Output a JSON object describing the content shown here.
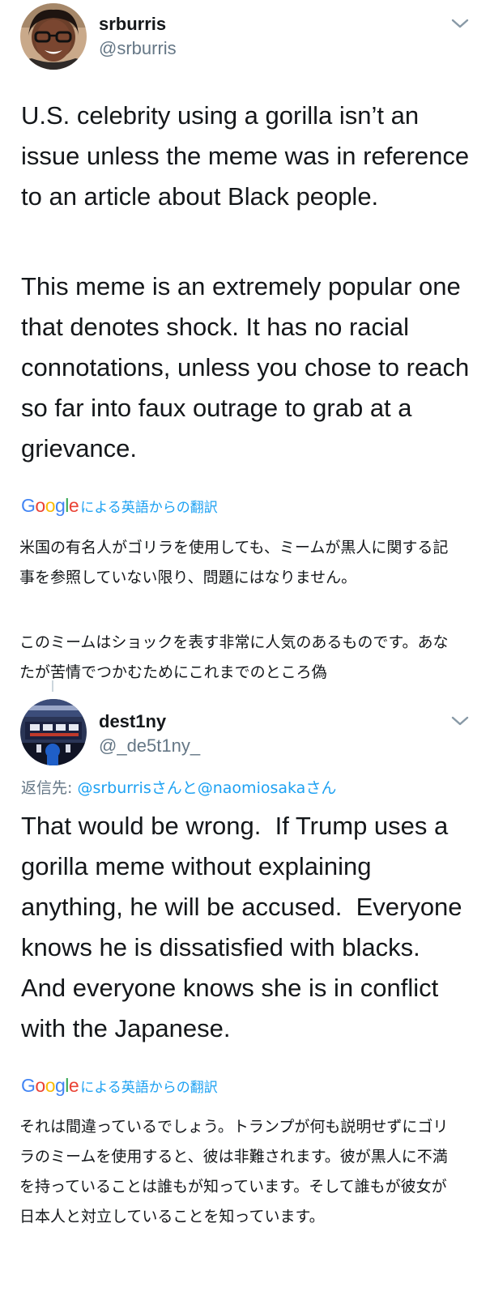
{
  "tweet1": {
    "display_name": "srburris",
    "handle": "@srburris",
    "paragraphs": [
      "U.S. celebrity using a gorilla isn’t an issue unless the meme was in reference to an article about Black people.",
      "This meme is an extremely popular one that denotes shock. It has no racial connotations, unless you chose to reach so far into faux outrage to grab at a grievance."
    ],
    "translate_label": "による英語からの翻訳",
    "translated_paragraphs": [
      "米国の有名人がゴリラを使用しても、ミームが黒人に関する記事を参照していない限り、問題にはなりません。",
      "このミームはショックを表す非常に人気のあるものです。あなたが苦情でつかむためにこれまでのところ偽"
    ]
  },
  "tweet2": {
    "display_name": "dest1ny",
    "handle": "@_de5t1ny_",
    "reply_prefix": "返信先: ",
    "reply_user1": "@srburris",
    "reply_san1": "さんと",
    "reply_user2": "@naomiosaka",
    "reply_san2": "さん",
    "text": "That would be wrong.  If Trump uses a gorilla meme without explaining anything, he will be accused.  Everyone knows he is dissatisfied with blacks.  And everyone knows she is in conflict with the Japanese.",
    "translate_label": "による英語からの翻訳",
    "translated_text": "それは間違っているでしょう。トランプが何も説明せずにゴリラのミームを使用すると、彼は非難されます。彼が黒人に不満を持っていることは誰もが知っています。そして誰もが彼女が日本人と対立していることを知っています。"
  },
  "google_logo": {
    "letters": [
      "G",
      "o",
      "o",
      "g",
      "l",
      "e"
    ],
    "colors": [
      "#4285F4",
      "#EA4335",
      "#FBBC05",
      "#4285F4",
      "#34A853",
      "#EA4335"
    ]
  },
  "colors": {
    "link_blue": "#1da1f2",
    "secondary_gray": "#657786",
    "text_primary": "#14171a"
  },
  "icons": {
    "menu": "chevron-down-icon"
  }
}
